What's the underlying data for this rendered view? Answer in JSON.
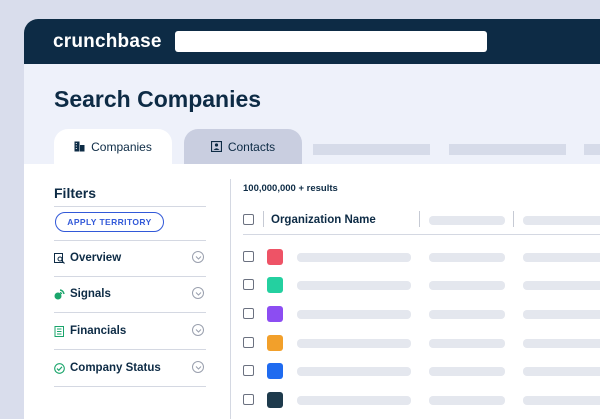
{
  "app": {
    "logo": "crunchbase"
  },
  "page": {
    "title": "Search Companies"
  },
  "tabs": [
    {
      "label": "Companies",
      "icon": "building-icon",
      "active": true
    },
    {
      "label": "Contacts",
      "icon": "contact-card-icon",
      "active": false
    }
  ],
  "filters": {
    "title": "Filters",
    "apply_button": "APPLY TERRITORY",
    "items": [
      {
        "label": "Overview",
        "icon": "overview-search-icon"
      },
      {
        "label": "Signals",
        "icon": "signals-icon"
      },
      {
        "label": "Financials",
        "icon": "financials-icon"
      },
      {
        "label": "Company Status",
        "icon": "company-status-icon"
      }
    ]
  },
  "results": {
    "count_label": "100,000,000 + results"
  },
  "table": {
    "columns": [
      "Organization  Name"
    ],
    "row_logo_colors": [
      "#ee5366",
      "#24d0a0",
      "#8c4df2",
      "#f2a02b",
      "#1f6bf0",
      "#1e3a4c"
    ]
  },
  "colors": {
    "header_bg": "#0d2b45",
    "accent": "#3259d8",
    "page_bg": "#d9ddec"
  }
}
